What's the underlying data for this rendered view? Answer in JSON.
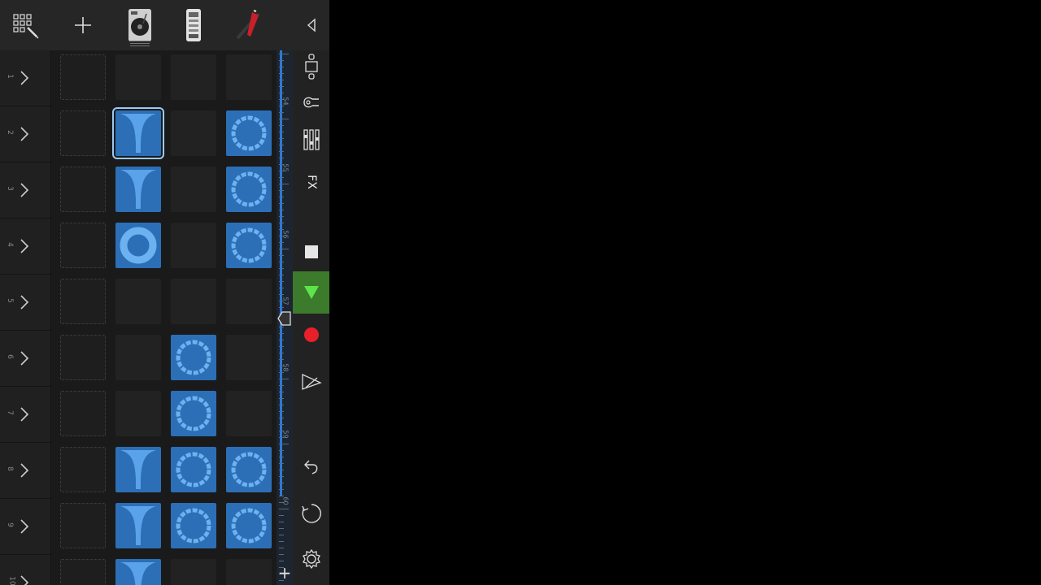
{
  "rows": [
    "1",
    "2",
    "3",
    "4",
    "5",
    "6",
    "7",
    "8",
    "9",
    "10"
  ],
  "ruler_labels": [
    "54",
    "55",
    "56",
    "57",
    "58",
    "59",
    "60"
  ],
  "controls": {
    "fx_label": "FX",
    "add_label": "+"
  },
  "colors": {
    "clip": "#2c6fb6",
    "record": "#e8202a",
    "play": "#5ee34a",
    "playhead_line": "#2a7ad8"
  },
  "toolbar": {
    "icons": [
      "grid-edit-icon",
      "add-icon",
      "turntable-instrument",
      "sampler-instrument",
      "guitar-instrument",
      "collapse-icon"
    ]
  }
}
